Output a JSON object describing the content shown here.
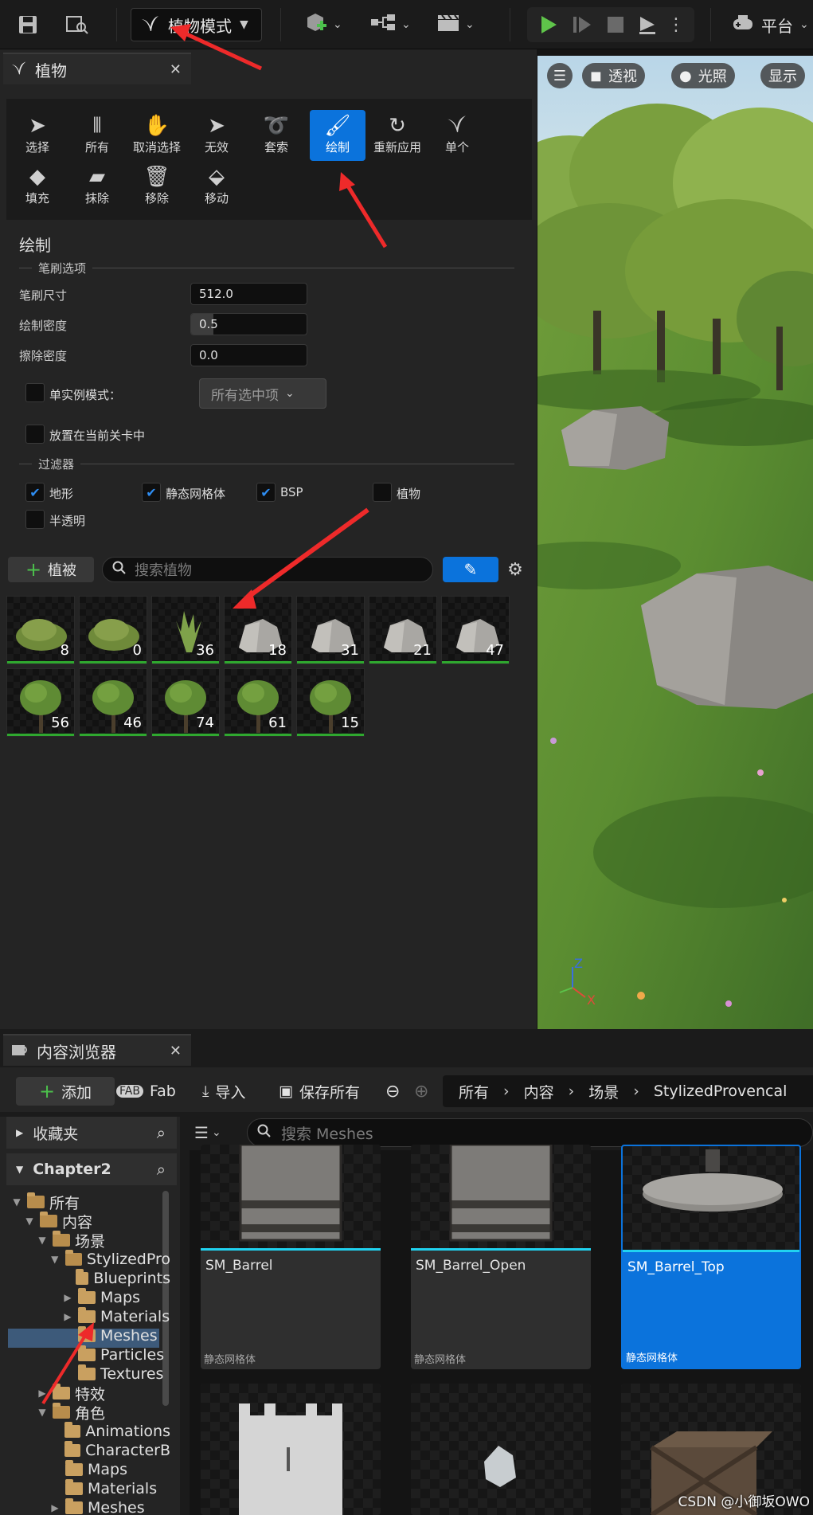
{
  "toolbar": {
    "mode_label": "植物模式",
    "platform_label": "平台"
  },
  "foliage_panel": {
    "tab_title": "植物",
    "tools_row1": [
      "选择",
      "所有",
      "取消选择",
      "无效",
      "套索",
      "绘制",
      "重新应用",
      "单个"
    ],
    "tools_row2": [
      "填充",
      "抹除",
      "移除",
      "移动"
    ],
    "active_tool": "绘制",
    "section_title": "绘制",
    "brush_group_label": "笔刷选项",
    "brush_size_label": "笔刷尺寸",
    "brush_size_value": "512.0",
    "paint_density_label": "绘制密度",
    "paint_density_value": "0.5",
    "paint_density_fraction": 0.5,
    "erase_density_label": "擦除密度",
    "erase_density_value": "0.0",
    "single_instance_label": "单实例模式：",
    "single_instance_select": "所有选中项",
    "place_in_level_label": "放置在当前关卡中",
    "filter_group_label": "过滤器",
    "filters": [
      {
        "label": "地形",
        "checked": true
      },
      {
        "label": "静态网格体",
        "checked": true
      },
      {
        "label": "BSP",
        "checked": true
      },
      {
        "label": "植物",
        "checked": false
      },
      {
        "label": "半透明",
        "checked": false
      }
    ],
    "add_foliage_label": "植被",
    "search_placeholder": "搜索植物",
    "foliage_counts_row1": [
      "8",
      "0",
      "36",
      "18",
      "31",
      "21",
      "47"
    ],
    "foliage_counts_row2": [
      "56",
      "46",
      "74",
      "61",
      "15"
    ]
  },
  "viewport": {
    "perspective_label": "透视",
    "lighting_label": "光照",
    "show_label": "显示",
    "axis_z": "Z",
    "axis_x": "X"
  },
  "content_browser": {
    "tab_title": "内容浏览器",
    "add_label": "添加",
    "fab_label": "Fab",
    "import_label": "导入",
    "save_all_label": "保存所有",
    "breadcrumb": [
      "所有",
      "内容",
      "场景",
      "StylizedProvencal"
    ],
    "favorites_label": "收藏夹",
    "project_label": "Chapter2",
    "search_placeholder": "搜索 Meshes",
    "tree": [
      {
        "label": "所有",
        "depth": 0,
        "arrow": "▼"
      },
      {
        "label": "内容",
        "depth": 1,
        "arrow": "▼"
      },
      {
        "label": "场景",
        "depth": 2,
        "arrow": "▼"
      },
      {
        "label": "StylizedPro",
        "depth": 3,
        "arrow": "▼"
      },
      {
        "label": "Blueprints",
        "depth": 4,
        "arrow": ""
      },
      {
        "label": "Maps",
        "depth": 4,
        "arrow": "▶"
      },
      {
        "label": "Materials",
        "depth": 4,
        "arrow": "▶"
      },
      {
        "label": "Meshes",
        "depth": 4,
        "arrow": ""
      },
      {
        "label": "Particles",
        "depth": 4,
        "arrow": ""
      },
      {
        "label": "Textures",
        "depth": 4,
        "arrow": ""
      },
      {
        "label": "特效",
        "depth": 2,
        "arrow": "▶"
      },
      {
        "label": "角色",
        "depth": 2,
        "arrow": "▼"
      },
      {
        "label": "Animations",
        "depth": 3,
        "arrow": ""
      },
      {
        "label": "CharacterB",
        "depth": 3,
        "arrow": ""
      },
      {
        "label": "Maps",
        "depth": 3,
        "arrow": ""
      },
      {
        "label": "Materials",
        "depth": 3,
        "arrow": ""
      },
      {
        "label": "Meshes",
        "depth": 3,
        "arrow": "▶"
      }
    ],
    "assets": [
      {
        "name": "SM_Barrel",
        "type": "静态网格体",
        "selected": false
      },
      {
        "name": "SM_Barrel_Open",
        "type": "静态网格体",
        "selected": false
      },
      {
        "name": "SM_Barrel_Top",
        "type": "静态网格体",
        "selected": true
      }
    ]
  },
  "watermark": "CSDN @小御坂OWO"
}
